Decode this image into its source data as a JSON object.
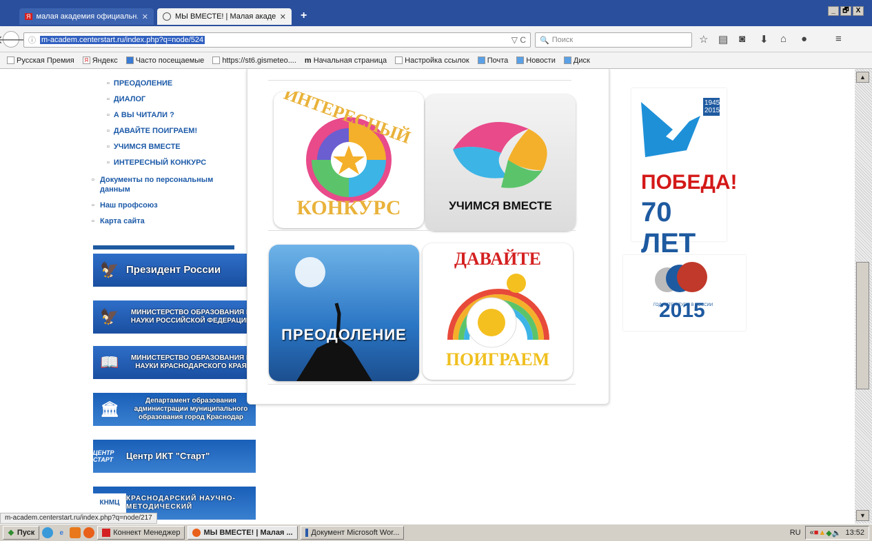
{
  "browser": {
    "tabs": [
      {
        "title": "малая академия официальн...",
        "close": "✕"
      },
      {
        "title": "МЫ ВМЕСТЕ! | Малая акаде...",
        "close": "✕"
      }
    ],
    "new_tab": "+",
    "window_controls": [
      "_",
      "🗗",
      "X"
    ],
    "url": "m-academ.centerstart.ru/index.php?q=node/524",
    "reload": "▽ C",
    "search_placeholder": "Поиск",
    "bookmarks": [
      "Русская Премия",
      "Яндекс",
      "Часто посещаемые",
      "https://st6.gismeteo....",
      "Начальная страница",
      "Настройка ссылок",
      "Почта",
      "Новости",
      "Диск"
    ]
  },
  "sidebar": {
    "submenu": [
      "ПРЕОДОЛЕНИЕ",
      "ДИАЛОГ",
      "А ВЫ ЧИТАЛИ ?",
      "ДАВАЙТЕ ПОИГРАЕМ!",
      "УЧИМСЯ ВМЕСТЕ",
      "ИНТЕРЕСНЫЙ КОНКУРС"
    ],
    "menu": [
      "Документы по персональным данным",
      "Наш профсоюз",
      "Карта сайта"
    ],
    "banners": [
      "Президент России",
      "МИНИСТЕРСТВО ОБРАЗОВАНИЯ И НАУКИ РОССИЙСКОЙ ФЕДЕРАЦИИ",
      "МИНИСТЕРСТВО ОБРАЗОВАНИЯ И НАУКИ КРАСНОДАРСКОГО КРАЯ",
      "Департамент образования администрации муниципального образования город Краснодар",
      "Центр ИКТ \"Старт\"",
      "КРАСНОДАРСКИЙ НАУЧНО-МЕТОДИЧЕСКИЙ"
    ],
    "banner_icons": [
      "🦅",
      "🦅",
      "📖",
      "🏛",
      "ЦЕНТР СТАРТ",
      "КНМЦ"
    ]
  },
  "tiles": {
    "t1_top": "ИНТЕРЕСНЫЙ",
    "t1_bottom": "КОНКУРС",
    "t2": "УЧИМСЯ ВМЕСТЕ",
    "t3": "ПРЕОДОЛЕНИЕ",
    "t4_top": "ДАВАЙТЕ",
    "t4_bottom": "ПОИГРАЕМ"
  },
  "right": {
    "years": "1945 2015",
    "pobeda": "ПОБЕДА!",
    "seventy": "70 ЛЕТ",
    "lit_caption": "ГОД ЛИТЕРАТУРЫ В РОССИИ",
    "lit_year": "2015"
  },
  "status_url": "m-academ.centerstart.ru/index.php?q=node/217",
  "taskbar": {
    "start": "Пуск",
    "tasks": [
      "Коннект Менеджер",
      "МЫ ВМЕСТЕ! | Малая ...",
      "Документ Microsoft Wor..."
    ],
    "lang": "RU",
    "time": "13:52"
  }
}
